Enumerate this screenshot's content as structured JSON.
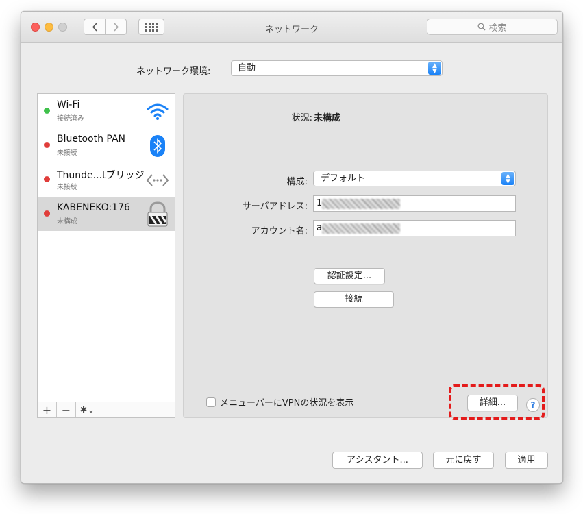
{
  "window": {
    "title": "ネットワーク",
    "search_placeholder": "検索"
  },
  "toolbar": {
    "back_icon": "chevron-left",
    "forward_icon": "chevron-right",
    "grid_icon": "show-all-grid"
  },
  "location": {
    "label": "ネットワーク環境:",
    "value": "自動"
  },
  "services": [
    {
      "name": "Wi-Fi",
      "status": "接続済み",
      "status_color": "#3fc14b",
      "icon": "wifi-icon"
    },
    {
      "name": "Bluetooth PAN",
      "status": "未接続",
      "status_color": "#e03d3a",
      "icon": "bluetooth-icon"
    },
    {
      "name": "Thunde...tブリッジ",
      "status": "未接続",
      "status_color": "#e03d3a",
      "icon": "thunderbolt-bridge-icon"
    },
    {
      "name": "KABENEKO:176",
      "status": "未構成",
      "status_color": "#e03d3a",
      "icon": "vpn-lock-icon",
      "selected": true
    }
  ],
  "sidebar_tools": {
    "add": "+",
    "remove": "−",
    "gear": "✱⌄"
  },
  "detail": {
    "status_label": "状況:",
    "status_value": "未構成",
    "config_label": "構成:",
    "config_value": "デフォルト",
    "server_label": "サーバアドレス:",
    "server_value": "1",
    "account_label": "アカウント名:",
    "account_value": "a",
    "auth_button": "認証設定...",
    "connect_button": "接続",
    "show_vpn_label": "メニューバーにVPNの状況を表示",
    "show_vpn_checked": false,
    "advanced_button": "詳細...",
    "help_button": "?"
  },
  "footer": {
    "assistant": "アシスタント...",
    "revert": "元に戻す",
    "apply": "適用"
  },
  "annotation": {
    "highlight_color": "#e41b1b"
  }
}
